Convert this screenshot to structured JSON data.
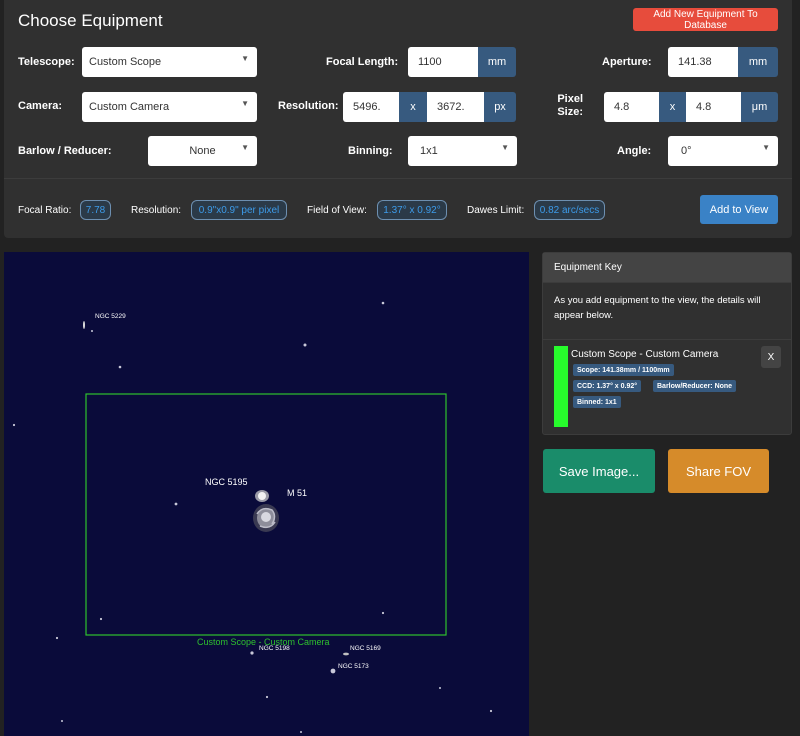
{
  "header": {
    "title": "Choose Equipment",
    "add_button": "Add New Equipment To Database"
  },
  "telescope": {
    "label": "Telescope:",
    "value": "Custom Scope"
  },
  "focal_length": {
    "label": "Focal Length:",
    "value": "1100",
    "unit": "mm"
  },
  "aperture": {
    "label": "Aperture:",
    "value": "141.38",
    "unit": "mm"
  },
  "camera": {
    "label": "Camera:",
    "value": "Custom Camera"
  },
  "resolution": {
    "label": "Resolution:",
    "width": "5496.",
    "sep": "x",
    "height": "3672.",
    "unit": "px"
  },
  "pixel_size": {
    "label_line1": "Pixel",
    "label_line2": "Size:",
    "width": "4.8",
    "sep": "x",
    "height": "4.8",
    "unit": "μm"
  },
  "barlow": {
    "label": "Barlow / Reducer:",
    "value": "None"
  },
  "binning": {
    "label": "Binning:",
    "value": "1x1"
  },
  "angle": {
    "label": "Angle:",
    "value": "0°"
  },
  "stats": {
    "focal_ratio_label": "Focal Ratio:",
    "focal_ratio": "7.78",
    "resolution_label": "Resolution:",
    "resolution": "0.9\"x0.9\" per pixel",
    "fov_label": "Field of View:",
    "fov": "1.37° x 0.92°",
    "dawes_label": "Dawes Limit:",
    "dawes": "0.82 arc/secs"
  },
  "add_to_view": "Add to View",
  "sky": {
    "objects": {
      "ngc5229": "NGC 5229",
      "ngc5195": "NGC 5195",
      "m51": "M 51",
      "ngc5198": "NGC 5198",
      "ngc5169": "NGC 5169",
      "ngc5173": "NGC 5173"
    },
    "fov_label": "Custom Scope - Custom Camera",
    "fov_color": "#2ec02e"
  },
  "key": {
    "title": "Equipment Key",
    "description": "As you add equipment to the view, the details will appear below.",
    "entry_name": "Custom Scope - Custom Camera",
    "entry_color": "#27fb2c",
    "close": "X",
    "scope": "Scope: 141.38mm / 1100mm",
    "ccd": "CCD: 1.37° x 0.92°",
    "barlow": "Barlow/Reducer: None",
    "binned": "Binned: 1x1"
  },
  "save_image": "Save Image...",
  "share_fov": "Share FOV",
  "colors": {
    "red": "#e74c3c",
    "blue": "#3a82c6",
    "navy": "#375a7f",
    "green": "#1a8c6a",
    "orange": "#d68b2a"
  }
}
